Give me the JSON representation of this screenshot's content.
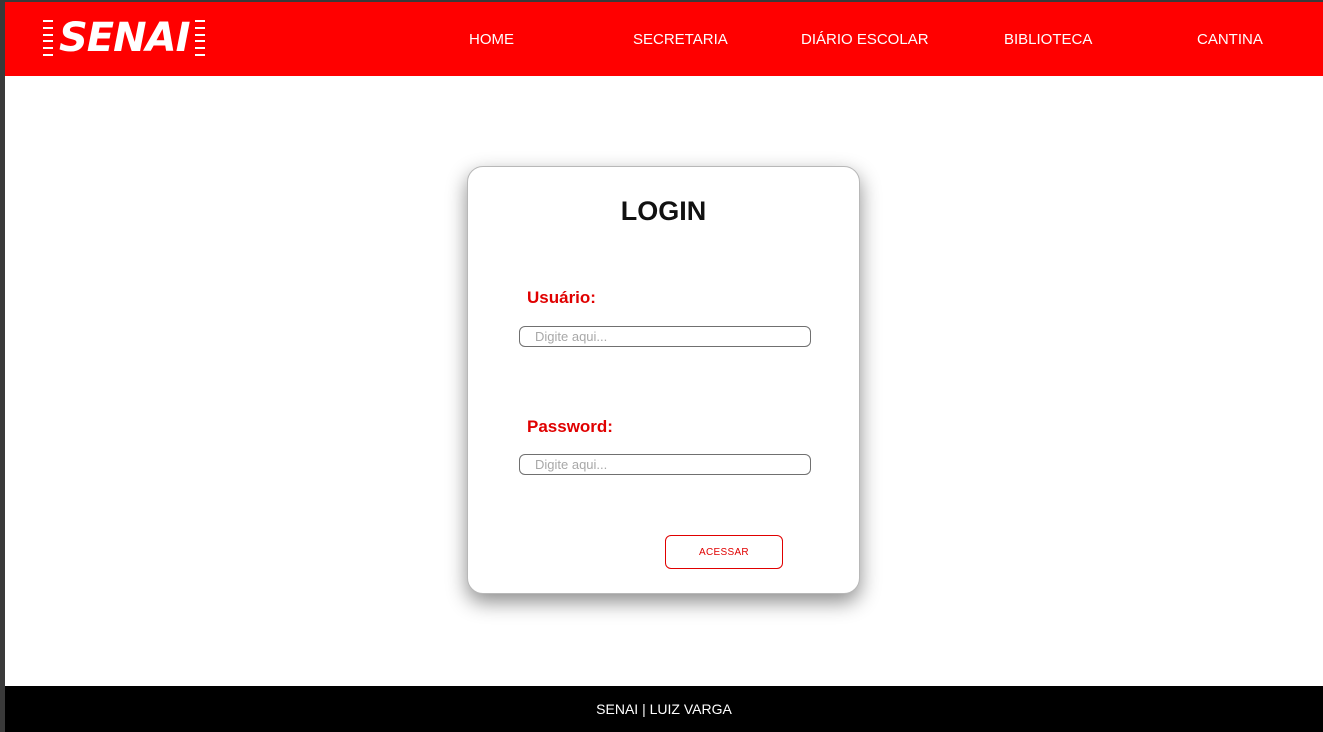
{
  "header": {
    "brand": "SENAI",
    "background_color": "#ff0000",
    "nav": [
      {
        "label": "HOME"
      },
      {
        "label": "SECRETARIA"
      },
      {
        "label": "DIÁRIO ESCOLAR"
      },
      {
        "label": "BIBLIOTECA"
      },
      {
        "label": "CANTINA"
      }
    ]
  },
  "login": {
    "title": "LOGIN",
    "username_label": "Usuário:",
    "username_placeholder": "Digite aqui...",
    "username_value": "",
    "password_label": "Password:",
    "password_placeholder": "Digite aqui...",
    "password_value": "",
    "submit_label": "ACESSAR",
    "accent_color": "#e00000"
  },
  "footer": {
    "text": "SENAI | LUIZ VARGA",
    "background_color": "#000000"
  }
}
